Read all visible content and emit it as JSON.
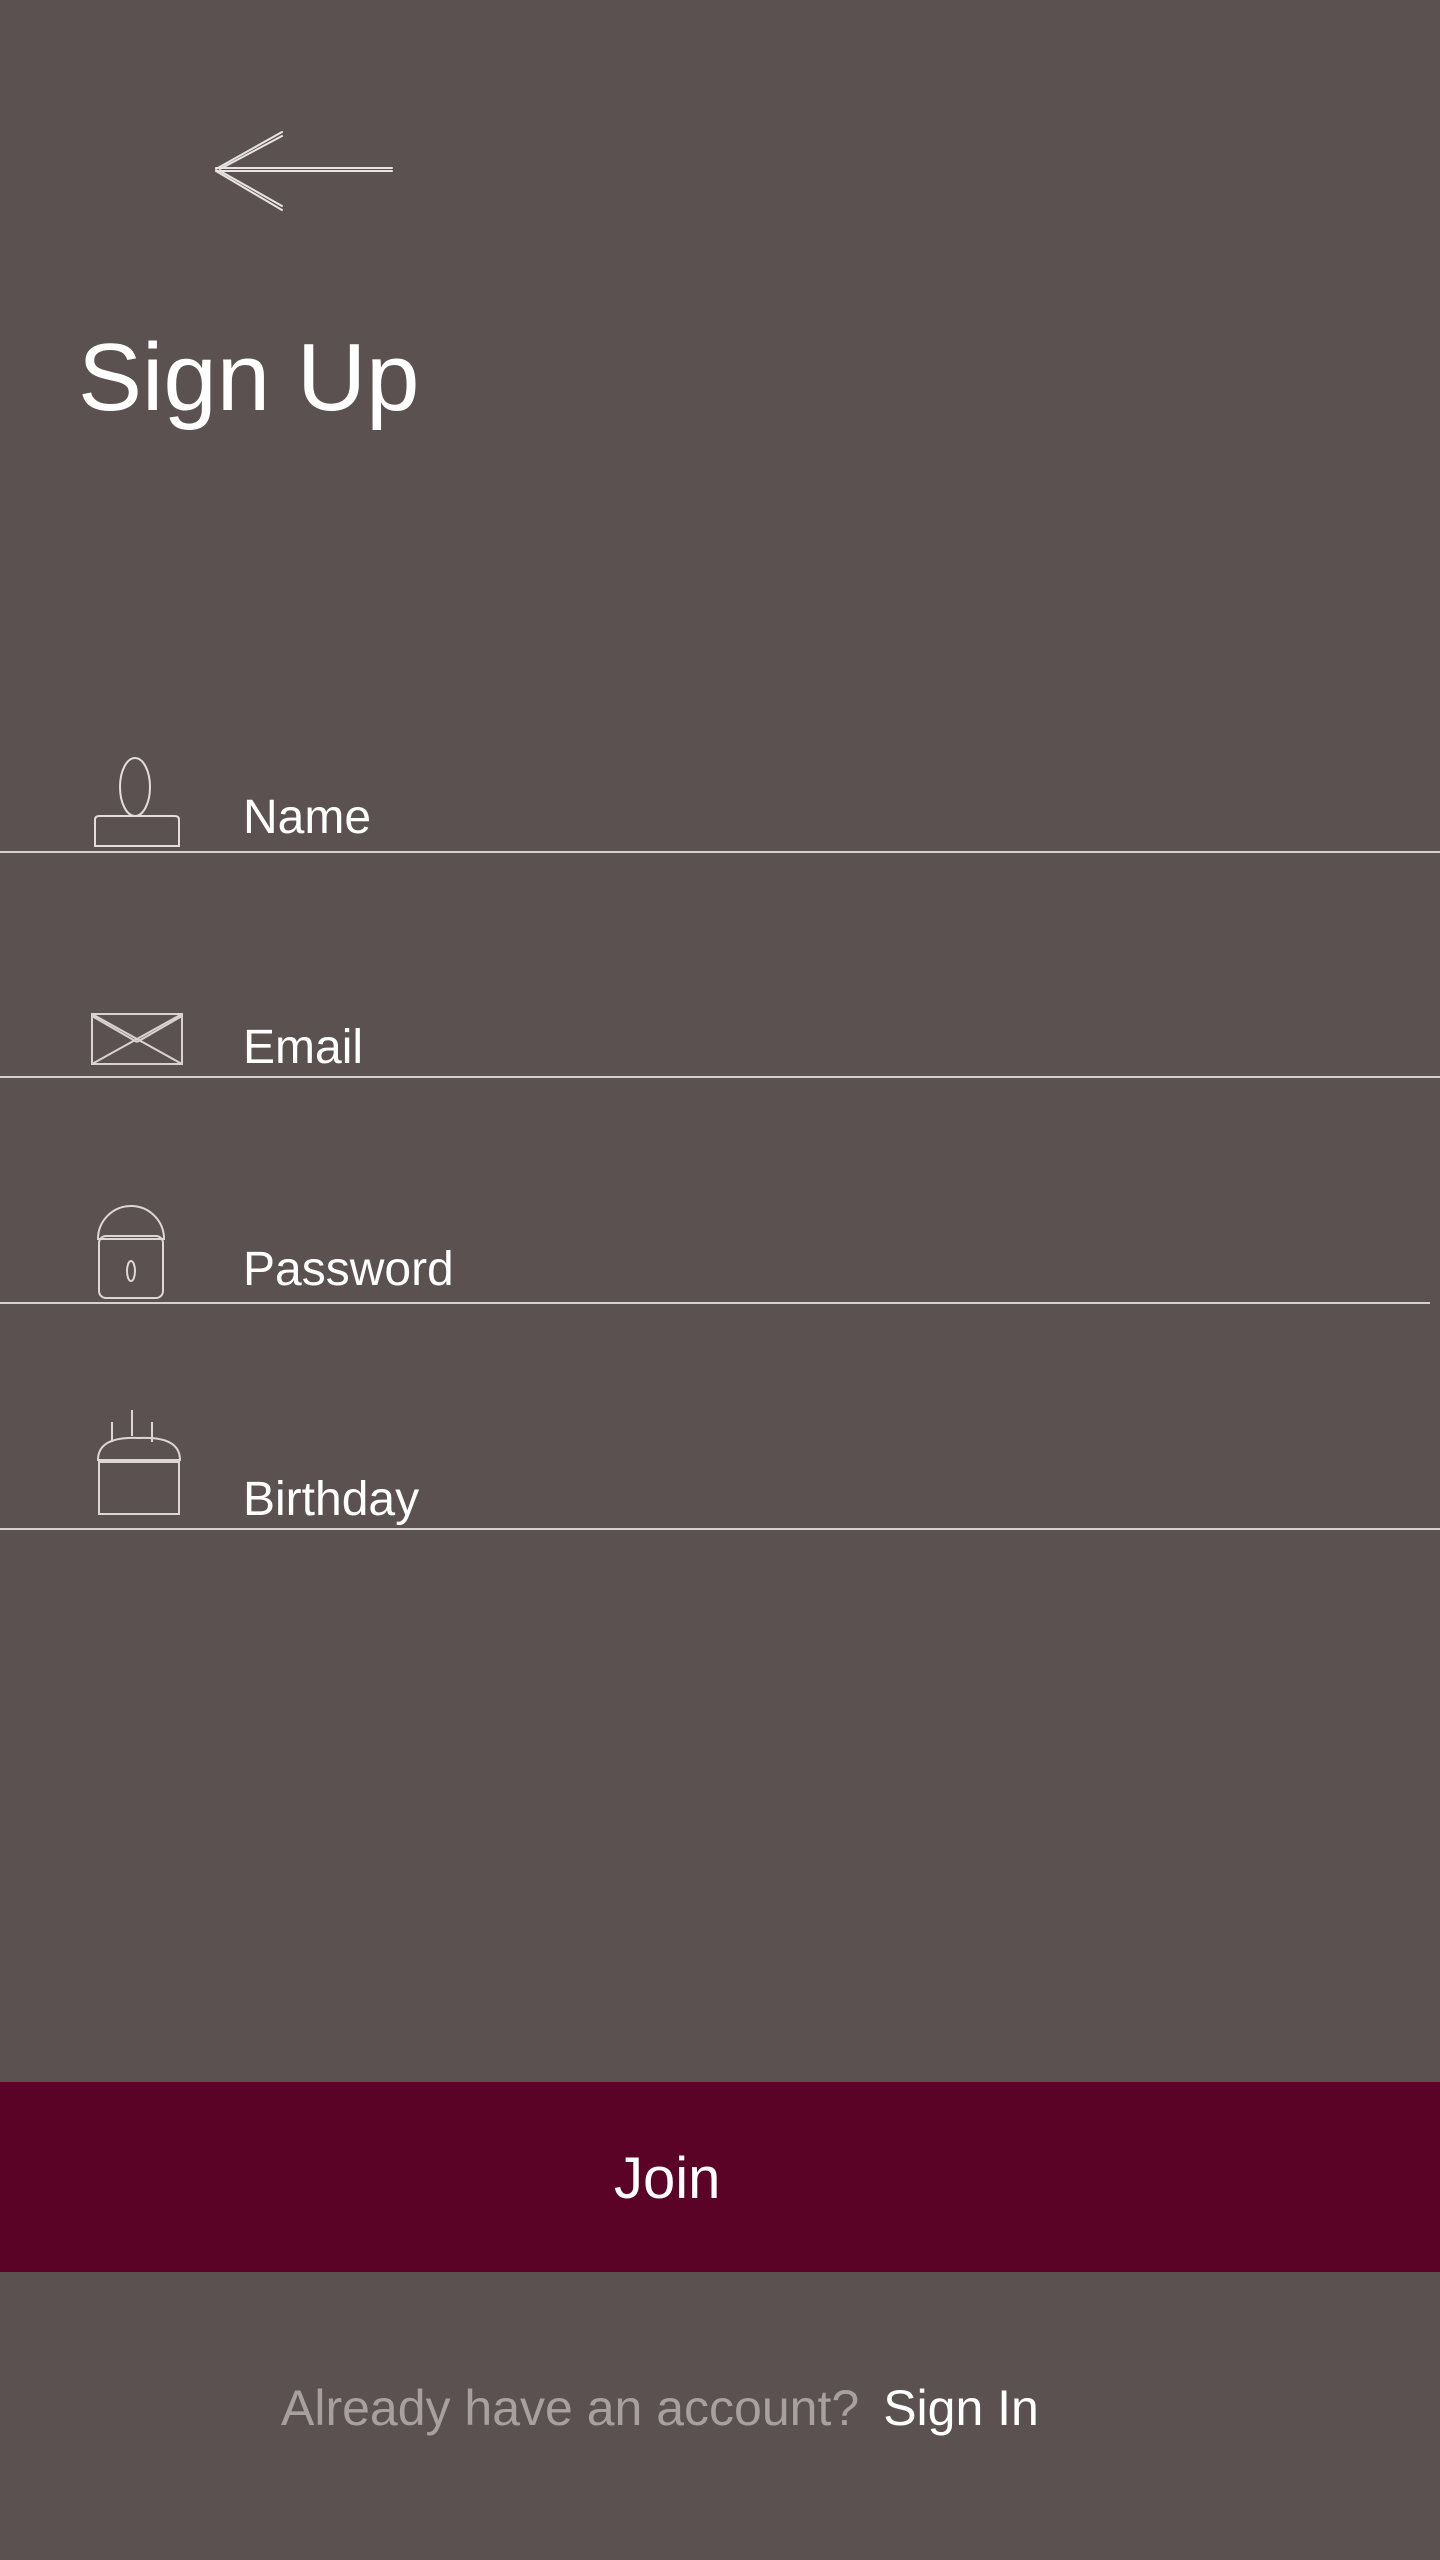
{
  "header": {
    "back_icon": "arrow-left-icon",
    "title": "Sign Up"
  },
  "form": {
    "fields": [
      {
        "label": "Name",
        "icon": "user-icon"
      },
      {
        "label": "Email",
        "icon": "envelope-icon"
      },
      {
        "label": "Password",
        "icon": "lock-icon"
      },
      {
        "label": "Birthday",
        "icon": "cake-icon"
      }
    ],
    "submit_label": "Join"
  },
  "footer": {
    "prompt": "Already have an account?",
    "sign_in_label": "Sign In"
  },
  "colors": {
    "background": "#5c5151",
    "accent": "#5b0326",
    "text": "#ffffff",
    "muted_text": "#a8a0a0",
    "line": "#d6d0d0"
  }
}
